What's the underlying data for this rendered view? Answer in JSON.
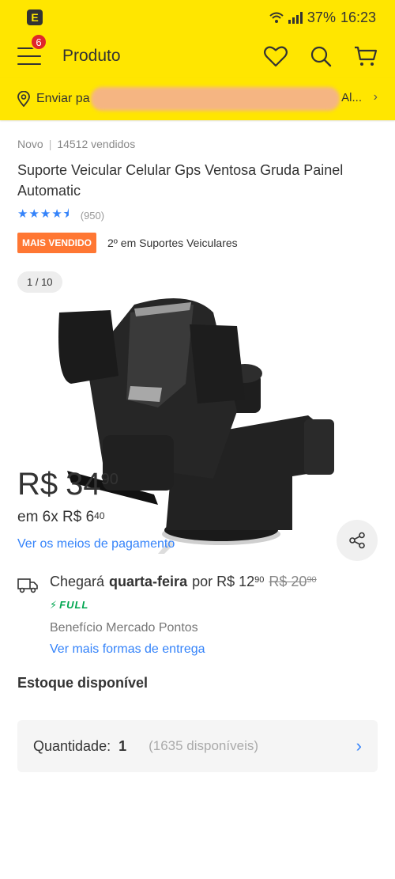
{
  "status_bar": {
    "left_icon": "E",
    "battery": "37%",
    "time": "16:23"
  },
  "header": {
    "cart_badge": "6",
    "title": "Produto"
  },
  "shipping_bar": {
    "label": "Enviar pa",
    "suffix": "Al...",
    "chevron": "›"
  },
  "product": {
    "condition": "Novo",
    "separator": "|",
    "sold": "14512 vendidos",
    "title": "Suporte Veicular Celular Gps Ventosa Gruda Painel Automatic",
    "rating_stars": 4.5,
    "rating_count": "(950)",
    "best_seller_badge": "MAIS VENDIDO",
    "best_seller_text": "2º em Suportes Veiculares",
    "image_counter": "1 / 10"
  },
  "price": {
    "currency": "R$",
    "integer": "34",
    "cents": "90"
  },
  "installments": {
    "prefix": "em 6x R$ 6",
    "cents": "40"
  },
  "payment_link": "Ver os meios de pagamento",
  "shipping": {
    "prefix": "Chegará",
    "day": "quarta-feira",
    "mid": "por R$ 12",
    "price_cents": "90",
    "old_price": "R$ 20",
    "old_cents": "90",
    "full_label": "FULL",
    "points": "Benefício Mercado Pontos",
    "more_link": "Ver mais formas de entrega"
  },
  "stock_label": "Estoque disponível",
  "quantity": {
    "label": "Quantidade:",
    "value": "1",
    "available": "(1635 disponíveis)",
    "chevron": "›"
  },
  "colors": {
    "brand_yellow": "#ffe600",
    "link_blue": "#3483fa",
    "best_seller": "#ff7733",
    "full_green": "#00a650",
    "badge_red": "#e0262b"
  }
}
